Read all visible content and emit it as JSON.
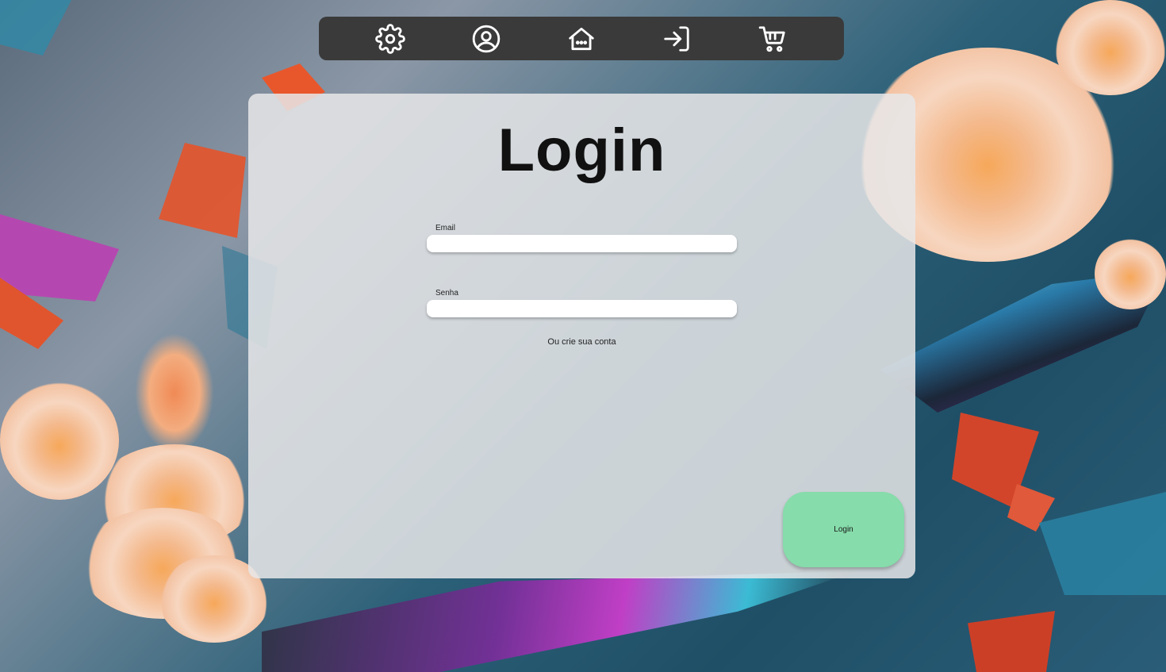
{
  "navbar": {
    "items": [
      {
        "icon": "gear-icon"
      },
      {
        "icon": "user-circle-icon"
      },
      {
        "icon": "home-icon"
      },
      {
        "icon": "sign-in-icon"
      },
      {
        "icon": "cart-icon"
      }
    ]
  },
  "login": {
    "title": "Login",
    "email_label": "Email",
    "email_value": "",
    "password_label": "Senha",
    "password_value": "",
    "create_account_text": "Ou crie sua conta",
    "submit_label": "Login"
  },
  "colors": {
    "navbar_bg": "#3a3a3a",
    "card_bg": "#e6e6e8",
    "login_button": "#86dcaa"
  }
}
